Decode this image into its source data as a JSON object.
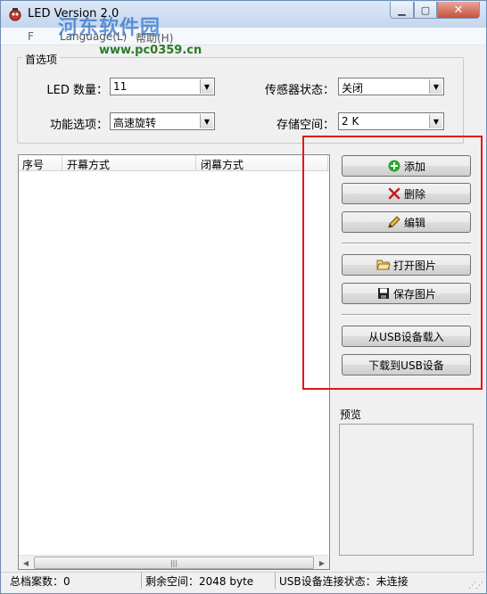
{
  "window": {
    "title": "LED   Version 2.0",
    "watermark_text": "河东软件园",
    "watermark_url": "www.pc0359.cn"
  },
  "menu": {
    "items": [
      "Language(L)",
      "帮助(H)"
    ]
  },
  "options": {
    "group_title": "首选项",
    "led_count_label": "LED 数量：",
    "led_count_value": "11",
    "sensor_label": "传感器状态：",
    "sensor_value": "关闭",
    "function_label": "功能选项：",
    "function_value": "高速旋转",
    "storage_label": "存储空间：",
    "storage_value": "2 K"
  },
  "list": {
    "columns": [
      "序号",
      "开幕方式",
      "闭幕方式"
    ],
    "rows": []
  },
  "buttons": {
    "add": "添加",
    "delete": "删除",
    "edit": "编辑",
    "open_image": "打开图片",
    "save_image": "保存图片",
    "load_usb": "从USB设备载入",
    "download_usb": "下载到USB设备"
  },
  "preview": {
    "label": "预览"
  },
  "status": {
    "total": "总档案数：0",
    "free_space": "剩余空间：2048 byte",
    "usb_state": "USB设备连接状态：未连接"
  },
  "colors": {
    "highlight": "#e4151d",
    "add_icon": "#2aa62a",
    "delete_icon": "#c41f1f"
  }
}
